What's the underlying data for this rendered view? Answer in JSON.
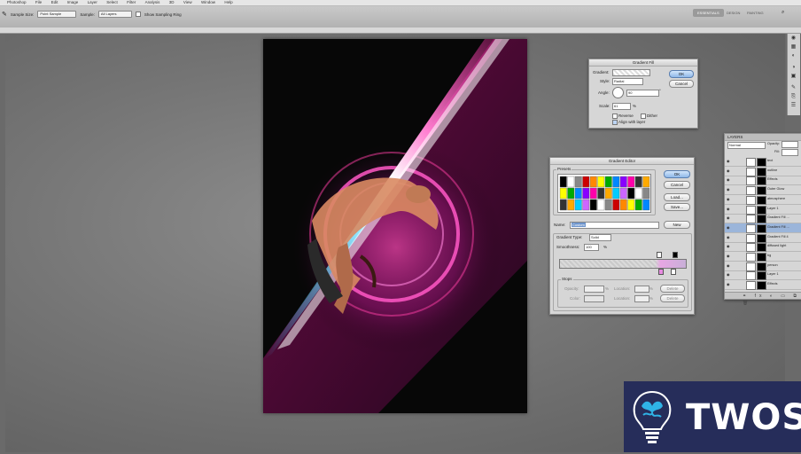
{
  "app": {
    "menu": [
      "Photoshop",
      "File",
      "Edit",
      "Image",
      "Layer",
      "Select",
      "Filter",
      "Analysis",
      "3D",
      "View",
      "Window",
      "Help"
    ]
  },
  "options_bar": {
    "sample_size_label": "Sample Size:",
    "sample_size_value": "Point Sample",
    "sample_label": "Sample:",
    "sample_value": "All Layers",
    "show_ring_label": "Show Sampling Ring",
    "workspace_tabs": [
      "ESSENTIALS",
      "DESIGN",
      "PAINTING"
    ]
  },
  "gradient_fill": {
    "title": "Gradient Fill",
    "gradient_label": "Gradient:",
    "style_label": "Style:",
    "style_value": "Radial",
    "angle_label": "Angle:",
    "angle_value": "90",
    "angle_unit": "°",
    "scale_label": "Scale:",
    "scale_value": "61",
    "scale_unit": "%",
    "reverse_label": "Reverse",
    "dither_label": "Dither",
    "align_label": "Align with layer",
    "ok_label": "OK",
    "cancel_label": "Cancel"
  },
  "gradient_editor": {
    "title": "Gradient Editor",
    "presets_label": "Presets",
    "ok_label": "OK",
    "cancel_label": "Cancel",
    "load_label": "Load...",
    "save_label": "Save...",
    "name_label": "Name:",
    "name_value": "Custom",
    "new_label": "New",
    "gradient_type_label": "Gradient Type:",
    "gradient_type_value": "Solid",
    "smoothness_label": "Smoothness:",
    "smoothness_value": "100",
    "smoothness_unit": "%",
    "stops_label": "Stops",
    "opacity_label": "Opacity:",
    "color_label": "Color:",
    "location_label": "Location:",
    "percent": "%",
    "delete_label": "Delete"
  },
  "layers_panel": {
    "title": "LAYERS",
    "blend_mode": "Normal",
    "opacity_label": "Opacity:",
    "fill_label": "Fill:",
    "rows": [
      "text",
      "outline",
      "Effects",
      "Outer Glow",
      "atmosphere",
      "Layer 1",
      "Gradient Fill ...",
      "Gradient Fill ...",
      "Gradient Fill 4",
      "diffused light",
      "bg",
      "person",
      "Layer 1",
      "Effects"
    ]
  },
  "watermark": {
    "brand": "TWOS",
    "colors": {
      "background": "#262d5a",
      "text": "#ffffff",
      "accent": "#2fb3e6"
    }
  }
}
